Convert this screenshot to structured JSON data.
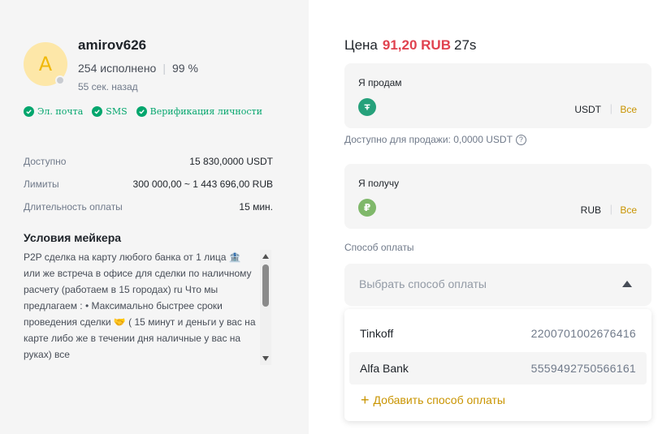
{
  "merchant": {
    "avatar_letter": "A",
    "username": "amirov626",
    "orders_completed": "254 исполнено",
    "completion_rate": "99 %",
    "last_seen": "55 сек. назад",
    "verifications": [
      "Эл. почта",
      "SMS",
      "Верификация личности"
    ]
  },
  "details": [
    {
      "label": "Доступно",
      "value": "15 830,0000 USDT"
    },
    {
      "label": "Лимиты",
      "value": "300 000,00 ~ 1 443 696,00 RUB"
    },
    {
      "label": "Длительность оплаты",
      "value": "15 мин."
    }
  ],
  "terms": {
    "title": "Условия мейкера",
    "text": "P2P сделка на карту любого банка от 1 лица 🏦 или же встреча в офисе для сделки по наличному расчету (работаем в 15 городах) ru Что мы предлагаем : • Максимально быстрее сроки проведения сделки 🤝 ( 15 минут и деньги у вас на карте либо же в течении дня наличные у вас на руках) все"
  },
  "trade": {
    "price_label": "Цена",
    "price_value": "91,20 RUB",
    "timer": "27s",
    "sell": {
      "label": "Я продам",
      "currency": "USDT",
      "all_label": "Все"
    },
    "available_to_sell": "Доступно для продажи: 0,0000 USDT",
    "receive": {
      "label": "Я получу",
      "currency": "RUB",
      "coin_symbol": "₽",
      "all_label": "Все"
    },
    "payment_label": "Способ оплаты",
    "payment_placeholder": "Выбрать способ оплаты",
    "payment_options": [
      {
        "bank": "Tinkoff",
        "number": "2200701002676416"
      },
      {
        "bank": "Alfa Bank",
        "number": "5559492750566161"
      }
    ],
    "add_payment_label": "Добавить способ оплаты"
  },
  "colors": {
    "accent": "#c99400",
    "price": "#e0424f",
    "verified": "#03a66d",
    "usdt_coin": "#26a17b",
    "rub_coin": "#7fb86a"
  }
}
